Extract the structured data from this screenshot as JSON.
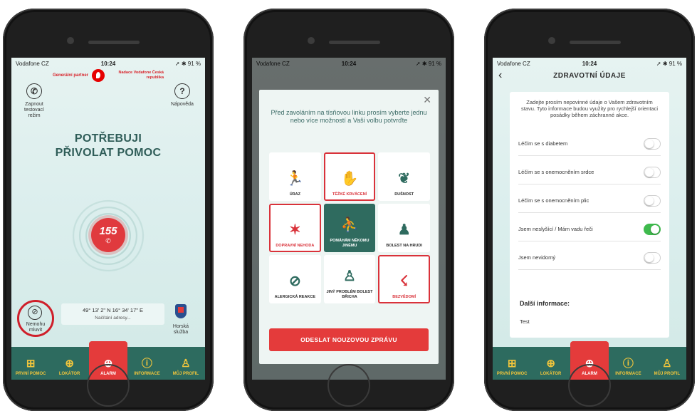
{
  "status": {
    "carrier": "Vodafone CZ",
    "time": "10:24",
    "battery": "91 %"
  },
  "tabs": [
    {
      "label": "PRVNÍ POMOC",
      "icon": "first-aid-kit-icon"
    },
    {
      "label": "LOKÁTOR",
      "icon": "crosshair-icon"
    },
    {
      "label": "ALARM",
      "icon": "plus-circle-icon"
    },
    {
      "label": "INFORMACE",
      "icon": "info-icon"
    },
    {
      "label": "MŮJ PROFIL",
      "icon": "person-icon"
    }
  ],
  "screen1": {
    "test_mode_label": "Zapnout testovací režim",
    "partner_label": "Generální partner",
    "partner_org": "Nadace Vodafone Česká republika",
    "help_label": "Nápověda",
    "title_line1": "POTŘEBUJI",
    "title_line2": "PŘIVOLAT POMOC",
    "emergency_number": "155",
    "coordinates": "49° 13' 2\" N 16° 34' 17\" E",
    "address_loading": "Načítání adresy...",
    "mute_label": "Nemohu mluvit",
    "mountain_label": "Horská služba"
  },
  "screen2": {
    "prompt": "Před zavoláním na tísňovou linku prosím vyberte jednu nebo více možností a Vaši volbu potvrďte",
    "options": [
      {
        "label": "ÚRAZ"
      },
      {
        "label": "TĚŽKÉ KRVÁCENÍ"
      },
      {
        "label": "DUŠNOST"
      },
      {
        "label": "DOPRAVNÍ NEHODA"
      },
      {
        "label": "POMÁHÁM NĚKOMU JINÉMU"
      },
      {
        "label": "BOLEST NA HRUDI"
      },
      {
        "label": "ALERGICKÁ REAKCE"
      },
      {
        "label": "JINÝ PROBLÉM BOLEST BŘICHA"
      },
      {
        "label": "BEZVĚDOMÍ"
      }
    ],
    "send_button": "ODESLAT NOUZOVOU ZPRÁVU"
  },
  "screen3": {
    "title": "ZDRAVOTNÍ ÚDAJE",
    "intro": "Zadejte prosím nepovinné údaje o Vašem zdravotním stavu. Tyto informace budou využity pro rychlejší orientaci posádky během záchranné akce.",
    "rows": [
      {
        "label": "Léčím se s diabetem",
        "on": false
      },
      {
        "label": "Léčím se s onemocněním srdce",
        "on": false
      },
      {
        "label": "Léčím se s onemocněním plic",
        "on": false
      },
      {
        "label": "Jsem neslyšící / Mám vadu řeči",
        "on": true
      },
      {
        "label": "Jsem nevidomý",
        "on": false
      }
    ],
    "more_heading": "Další informace:",
    "more_value": "Test"
  },
  "colors": {
    "accent_red": "#e43b3b",
    "teal": "#2d6b5f",
    "tab_icon": "#f1c53c",
    "toggle_on": "#3fba4d"
  }
}
